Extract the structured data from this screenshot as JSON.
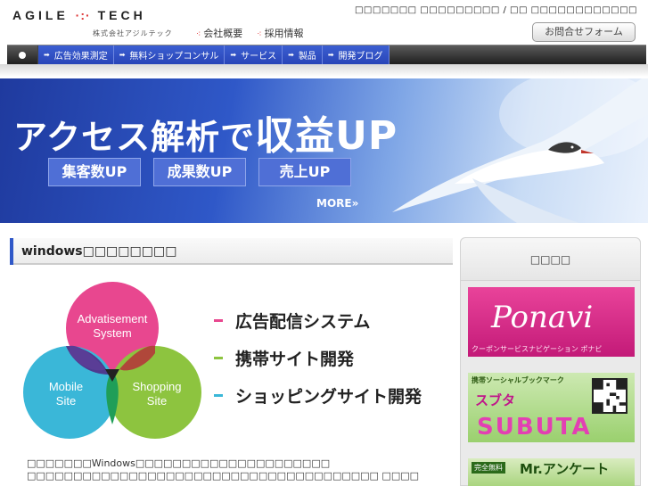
{
  "header": {
    "logo_left": "AGILE",
    "logo_dots": "·:·",
    "logo_right": "TECH",
    "logo_sub": "株式会社アジルテック",
    "links": [
      {
        "label": "会社概要"
      },
      {
        "label": "採用情報"
      }
    ],
    "lang_text": "□□□□□□□ □□□□□□□□□ / □□ □□□□□□□□□□□□",
    "contact_label": "お問合せフォーム"
  },
  "nav": {
    "items": [
      {
        "label": "広告効果測定"
      },
      {
        "label": "無料ショップコンサル"
      },
      {
        "label": "サービス"
      },
      {
        "label": "製品"
      },
      {
        "label": "開発ブログ"
      }
    ]
  },
  "hero": {
    "title_prefix": "アクセス解析で",
    "title_main": "収益UP",
    "pills": [
      {
        "label": "集客数UP"
      },
      {
        "label": "成果数UP"
      },
      {
        "label": "売上UP"
      }
    ],
    "more_label": "MORE»"
  },
  "main": {
    "section_title": "windows□□□□□□□□",
    "venn": {
      "top": "Advatisement System",
      "left": "Mobile Site",
      "right": "Shopping Site"
    },
    "legend": [
      {
        "label": "広告配信システム",
        "color": "#e8478f"
      },
      {
        "label": "携帯サイト開発",
        "color": "#8dc43f"
      },
      {
        "label": "ショッピングサイト開発",
        "color": "#3ab7d8"
      }
    ],
    "description": "□□□□□□□Windows□□□□□□□□□□□□□□□□□□□□□ □□□□□□□□□□□□□□□□□□□□□□□□□□□□□□□□□□□□□□ □□□□"
  },
  "sidebar": {
    "title": "□□□□",
    "banner1": {
      "title": "Ponavi",
      "sub": "クーポンサービスナビゲーション ポナビ"
    },
    "banner2": {
      "sub1": "携帯ソーシャルブックマーク",
      "sub2": "スブタ",
      "title": "SUBUTA"
    },
    "banner3": {
      "tag": "完全無料",
      "title": "Mr.アンケート"
    }
  }
}
